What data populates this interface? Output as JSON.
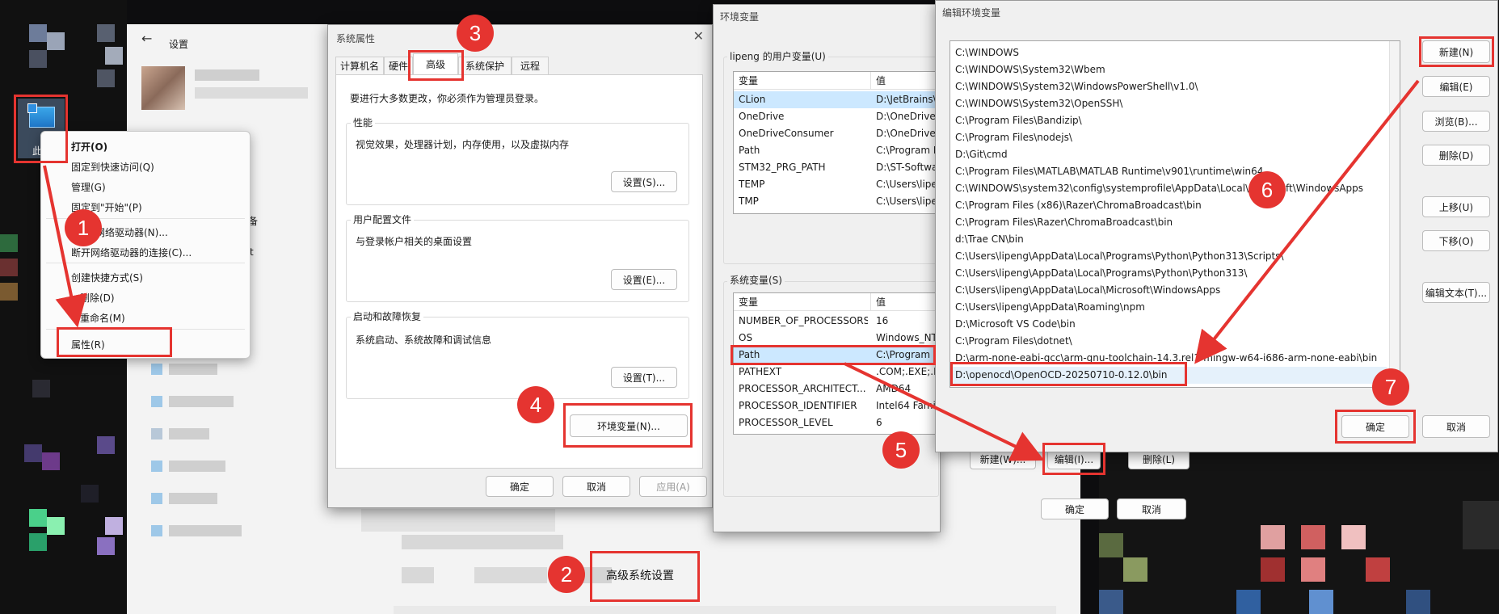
{
  "settings": {
    "title": "设置",
    "back_icon": "arrow-left-icon",
    "partial_1": "备",
    "partial_2": "t",
    "adv_link": "高级系统设置"
  },
  "context_menu": {
    "items": [
      "打开(O)",
      "固定到快速访问(Q)",
      "管理(G)",
      "固定到\"开始\"(P)",
      "网络驱动器(N)...",
      "断开网络驱动器的连接(C)...",
      "创建快捷方式(S)",
      "删除(D)",
      "重命名(M)",
      "属性(R)"
    ],
    "desktop_icon_label": "此"
  },
  "sysprops": {
    "title": "系统属性",
    "tabs": [
      "计算机名",
      "硬件",
      "高级",
      "系统保护",
      "远程"
    ],
    "admin_note": "要进行大多数更改，你必须作为管理员登录。",
    "perf": {
      "label": "性能",
      "desc": "视觉效果，处理器计划，内存使用，以及虚拟内存",
      "btn": "设置(S)..."
    },
    "profile": {
      "label": "用户配置文件",
      "desc": "与登录帐户相关的桌面设置",
      "btn": "设置(E)..."
    },
    "startup": {
      "label": "启动和故障恢复",
      "desc": "系统启动、系统故障和调试信息",
      "btn": "设置(T)..."
    },
    "env_btn": "环境变量(N)...",
    "ok": "确定",
    "cancel": "取消",
    "apply": "应用(A)"
  },
  "envvars": {
    "title": "环境变量",
    "user_group": "lipeng 的用户变量(U)",
    "col_var": "变量",
    "col_val": "值",
    "user_vars": [
      {
        "name": "CLion",
        "value": "D:\\JetBrains\\"
      },
      {
        "name": "OneDrive",
        "value": "D:\\OneDrive"
      },
      {
        "name": "OneDriveConsumer",
        "value": "D:\\OneDrive"
      },
      {
        "name": "Path",
        "value": "C:\\Program F"
      },
      {
        "name": "STM32_PRG_PATH",
        "value": "D:\\ST-Softwa"
      },
      {
        "name": "TEMP",
        "value": "C:\\Users\\lipe"
      },
      {
        "name": "TMP",
        "value": "C:\\Users\\lipe"
      }
    ],
    "sys_group": "系统变量(S)",
    "sys_vars": [
      {
        "name": "NUMBER_OF_PROCESSORS",
        "value": "16"
      },
      {
        "name": "OS",
        "value": "Windows_NT"
      },
      {
        "name": "Path",
        "value": "C:\\Program"
      },
      {
        "name": "PATHEXT",
        "value": ".COM;.EXE;.B"
      },
      {
        "name": "PROCESSOR_ARCHITECT...",
        "value": "AMD64"
      },
      {
        "name": "PROCESSOR_IDENTIFIER",
        "value": "Intel64 Famil"
      },
      {
        "name": "PROCESSOR_LEVEL",
        "value": "6"
      }
    ],
    "new_btn": "新建(W)...",
    "edit_btn": "编辑(I)...",
    "delete_btn": "删除(L)",
    "ok": "确定",
    "cancel": "取消"
  },
  "editenv": {
    "title": "编辑环境变量",
    "paths": [
      "C:\\WINDOWS",
      "C:\\WINDOWS\\System32\\Wbem",
      "C:\\WINDOWS\\System32\\WindowsPowerShell\\v1.0\\",
      "C:\\WINDOWS\\System32\\OpenSSH\\",
      "C:\\Program Files\\Bandizip\\",
      "C:\\Program Files\\nodejs\\",
      "D:\\Git\\cmd",
      "C:\\Program Files\\MATLAB\\MATLAB Runtime\\v901\\runtime\\win64",
      "C:\\WINDOWS\\system32\\config\\systemprofile\\AppData\\Local\\Microsoft\\WindowsApps",
      "C:\\Program Files (x86)\\Razer\\ChromaBroadcast\\bin",
      "C:\\Program Files\\Razer\\ChromaBroadcast\\bin",
      "d:\\Trae CN\\bin",
      "C:\\Users\\lipeng\\AppData\\Local\\Programs\\Python\\Python313\\Scripts\\",
      "C:\\Users\\lipeng\\AppData\\Local\\Programs\\Python\\Python313\\",
      "C:\\Users\\lipeng\\AppData\\Local\\Microsoft\\WindowsApps",
      "C:\\Users\\lipeng\\AppData\\Roaming\\npm",
      "D:\\Microsoft VS Code\\bin",
      "C:\\Program Files\\dotnet\\",
      "D:\\arm-none-eabi-gcc\\arm-gnu-toolchain-14.3.rel1-mingw-w64-i686-arm-none-eabi\\bin",
      "D:\\openocd\\OpenOCD-20250710-0.12.0\\bin"
    ],
    "new_btn": "新建(N)",
    "edit_btn": "编辑(E)",
    "browse_btn": "浏览(B)...",
    "delete_btn": "删除(D)",
    "up_btn": "上移(U)",
    "down_btn": "下移(O)",
    "edit_text_btn": "编辑文本(T)...",
    "ok": "确定",
    "cancel": "取消"
  },
  "steps": [
    "1",
    "2",
    "3",
    "4",
    "5",
    "6",
    "7"
  ],
  "colors": {
    "annotation": "#e53430",
    "selection": "#cce8ff"
  }
}
